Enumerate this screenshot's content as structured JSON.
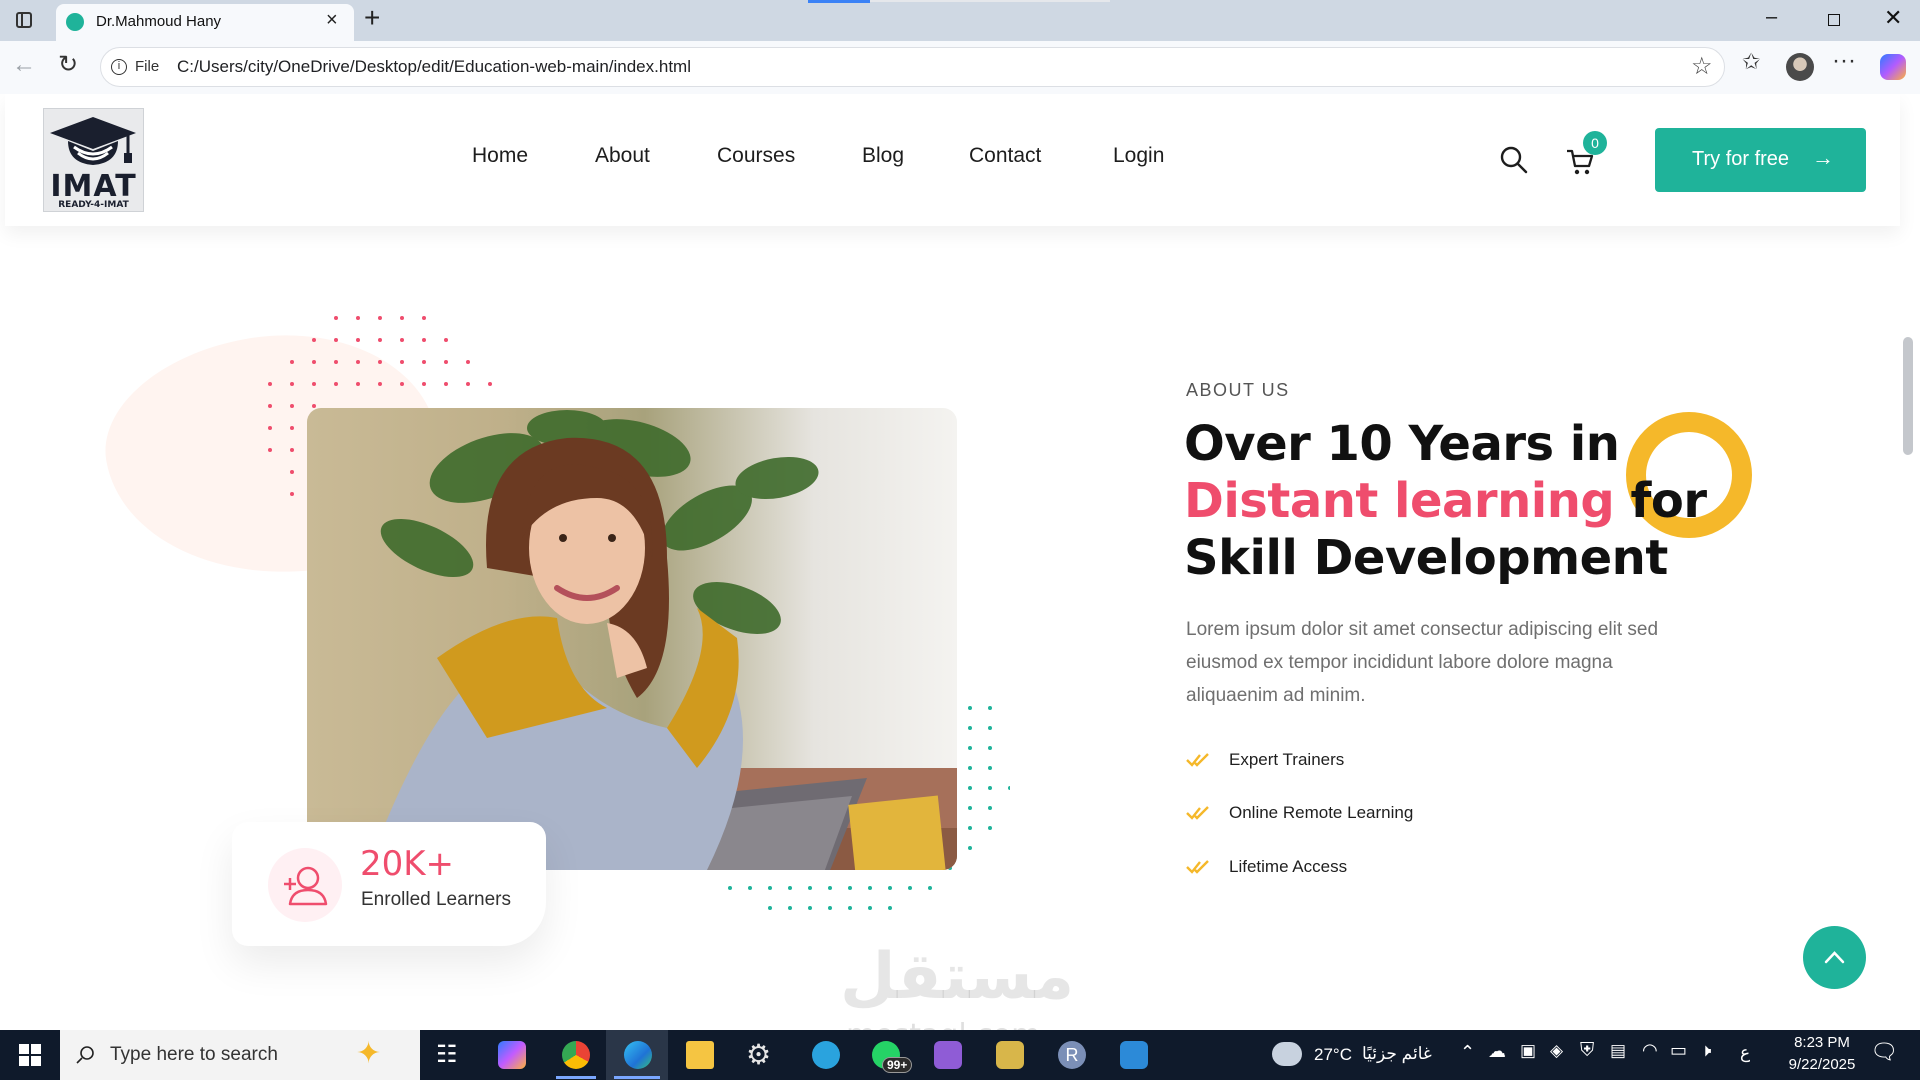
{
  "browser": {
    "tab_title": "Dr.Mahmoud Hany",
    "address_scheme": "File",
    "address_url": "C:/Users/city/OneDrive/Desktop/edit/Education-web-main/index.html"
  },
  "site": {
    "logo_text": "IMAT",
    "logo_subtext": "READY-4-IMAT",
    "nav": [
      "Home",
      "About",
      "Courses",
      "Blog",
      "Contact",
      "Login"
    ],
    "cart_count": "0",
    "cta_label": "Try for free"
  },
  "about": {
    "eyebrow": "ABOUT US",
    "heading_line1": "Over 10 Years in",
    "heading_highlight": "Distant learning",
    "heading_for": "for",
    "heading_line3": "Skill Development",
    "description": "Lorem ipsum dolor sit amet consectur adipiscing elit sed eiusmod ex tempor incididunt labore dolore magna aliquaenim ad minim.",
    "features": [
      "Expert Trainers",
      "Online Remote Learning",
      "Lifetime Access"
    ],
    "stat_value": "20K+",
    "stat_label": "Enrolled Learners"
  },
  "watermark": {
    "arabic": "مستقل",
    "latin": "mostaql.com"
  },
  "taskbar": {
    "search_placeholder": "Type here to search",
    "weather_temp": "27°C",
    "weather_text": "غائم جزئيًا",
    "whatsapp_badge": "99+",
    "lang": "ع",
    "time": "8:23 PM",
    "date": "9/22/2025"
  },
  "colors": {
    "accent_teal": "#1fb39a",
    "accent_red": "#ef4d6d",
    "accent_yellow": "#f5b82a"
  }
}
